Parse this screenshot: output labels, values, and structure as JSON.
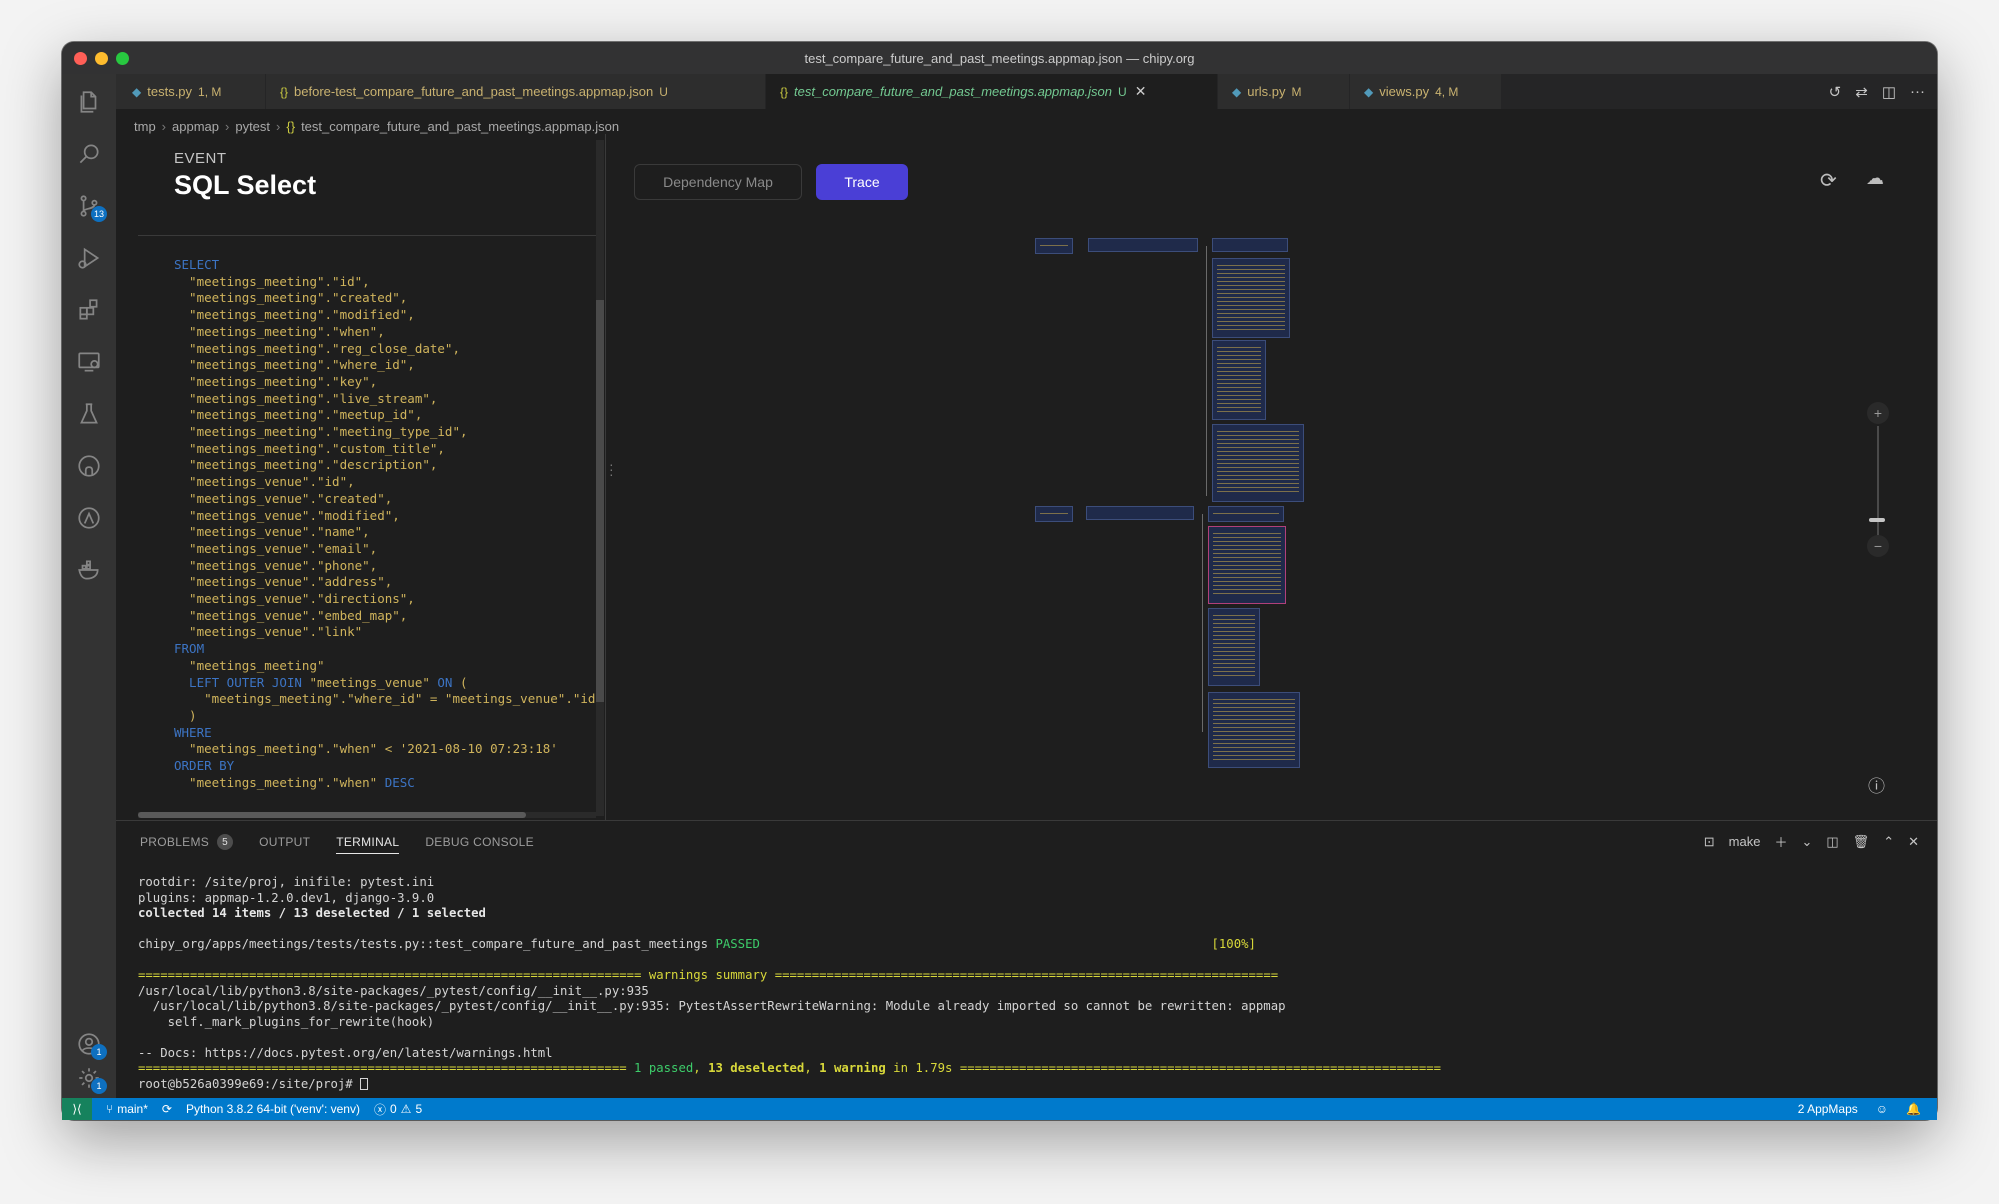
{
  "window": {
    "title": "test_compare_future_and_past_meetings.appmap.json — chipy.org"
  },
  "activity_bar": {
    "source_control_badge": "13",
    "accounts_badge": "1",
    "settings_badge": "1"
  },
  "tabs": [
    {
      "icon": "python-icon",
      "label": "tests.py",
      "status": "1, M"
    },
    {
      "icon": "json-icon",
      "label": "before-test_compare_future_and_past_meetings.appmap.json",
      "status": "U"
    },
    {
      "icon": "json-icon",
      "label": "test_compare_future_and_past_meetings.appmap.json",
      "status": "U",
      "active": true
    },
    {
      "icon": "python-icon",
      "label": "urls.py",
      "status": "M"
    },
    {
      "icon": "python-icon",
      "label": "views.py",
      "status": "4, M"
    }
  ],
  "breadcrumb": [
    "tmp",
    "appmap",
    "pytest",
    "test_compare_future_and_past_meetings.appmap.json"
  ],
  "event": {
    "label": "EVENT",
    "title": "SQL Select"
  },
  "sql_lines": [
    {
      "kw": "SELECT",
      "text": ""
    },
    {
      "kw": "",
      "text": "  \"meetings_meeting\".\"id\","
    },
    {
      "kw": "",
      "text": "  \"meetings_meeting\".\"created\","
    },
    {
      "kw": "",
      "text": "  \"meetings_meeting\".\"modified\","
    },
    {
      "kw": "",
      "text": "  \"meetings_meeting\".\"when\","
    },
    {
      "kw": "",
      "text": "  \"meetings_meeting\".\"reg_close_date\","
    },
    {
      "kw": "",
      "text": "  \"meetings_meeting\".\"where_id\","
    },
    {
      "kw": "",
      "text": "  \"meetings_meeting\".\"key\","
    },
    {
      "kw": "",
      "text": "  \"meetings_meeting\".\"live_stream\","
    },
    {
      "kw": "",
      "text": "  \"meetings_meeting\".\"meetup_id\","
    },
    {
      "kw": "",
      "text": "  \"meetings_meeting\".\"meeting_type_id\","
    },
    {
      "kw": "",
      "text": "  \"meetings_meeting\".\"custom_title\","
    },
    {
      "kw": "",
      "text": "  \"meetings_meeting\".\"description\","
    },
    {
      "kw": "",
      "text": "  \"meetings_venue\".\"id\","
    },
    {
      "kw": "",
      "text": "  \"meetings_venue\".\"created\","
    },
    {
      "kw": "",
      "text": "  \"meetings_venue\".\"modified\","
    },
    {
      "kw": "",
      "text": "  \"meetings_venue\".\"name\","
    },
    {
      "kw": "",
      "text": "  \"meetings_venue\".\"email\","
    },
    {
      "kw": "",
      "text": "  \"meetings_venue\".\"phone\","
    },
    {
      "kw": "",
      "text": "  \"meetings_venue\".\"address\","
    },
    {
      "kw": "",
      "text": "  \"meetings_venue\".\"directions\","
    },
    {
      "kw": "",
      "text": "  \"meetings_venue\".\"embed_map\","
    },
    {
      "kw": "",
      "text": "  \"meetings_venue\".\"link\""
    },
    {
      "kw": "FROM",
      "text": ""
    },
    {
      "kw": "",
      "text": "  \"meetings_meeting\""
    },
    {
      "kw": "  LEFT OUTER JOIN",
      "text": " \"meetings_venue\" ",
      "kw2": "ON",
      "text2": " ("
    },
    {
      "kw": "",
      "text": "    \"meetings_meeting\".\"where_id\" = \"meetings_venue\".\"id\""
    },
    {
      "kw": "",
      "text": "  )"
    },
    {
      "kw": "WHERE",
      "text": ""
    },
    {
      "kw": "",
      "text": "  \"meetings_meeting\".\"when\" < '2021-08-10 07:23:18'"
    },
    {
      "kw": "ORDER BY",
      "text": ""
    },
    {
      "kw": "",
      "text": "  \"meetings_meeting\".\"when\" ",
      "kw2": "DESC",
      "text2": ""
    }
  ],
  "appmap": {
    "dependency_map_label": "Dependency Map",
    "trace_label": "Trace"
  },
  "panel": {
    "tabs": [
      {
        "label": "PROBLEMS",
        "badge": "5"
      },
      {
        "label": "OUTPUT"
      },
      {
        "label": "TERMINAL",
        "active": true
      },
      {
        "label": "DEBUG CONSOLE"
      }
    ],
    "terminal_task": "make"
  },
  "terminal": {
    "line1": "rootdir: /site/proj, inifile: pytest.ini",
    "line2": "plugins: appmap-1.2.0.dev1, django-3.9.0",
    "line3": "collected 14 items / 13 deselected / 1 selected",
    "test_path": "chipy_org/apps/meetings/tests/tests.py::test_compare_future_and_past_meetings ",
    "test_result": "PASSED",
    "test_percent": "[100%]",
    "warn_sep_left": "==================================================================== ",
    "warn_title": "warnings summary",
    "warn_sep_right": " ====================================================================",
    "warn1": "/usr/local/lib/python3.8/site-packages/_pytest/config/__init__.py:935",
    "warn2": "  /usr/local/lib/python3.8/site-packages/_pytest/config/__init__.py:935: PytestAssertRewriteWarning: Module already imported so cannot be rewritten: appmap",
    "warn3": "    self._mark_plugins_for_rewrite(hook)",
    "docs": "-- Docs: https://docs.pytest.org/en/latest/warnings.html",
    "sum_sep_left": "================================================================== ",
    "sum_passed": "1 passed",
    "sum_comma1": ", ",
    "sum_deselected": "13 deselected",
    "sum_comma2": ", ",
    "sum_warning": "1 warning",
    "sum_time": " in 1.79s ",
    "sum_sep_right": "=================================================================",
    "prompt": "root@b526a0399e69:/site/proj# "
  },
  "status": {
    "branch": "main*",
    "python": "Python 3.8.2 64-bit ('venv': venv)",
    "errors": "0",
    "warnings": "5",
    "appmaps": "2 AppMaps"
  },
  "colors": {
    "accent_trace": "#4a3fd6",
    "status_bar": "#007acc",
    "sql_keyword": "#3c74c4",
    "sql_text": "#d7ba7d",
    "passed": "#3dcc6a",
    "warning": "#d8d83a"
  }
}
